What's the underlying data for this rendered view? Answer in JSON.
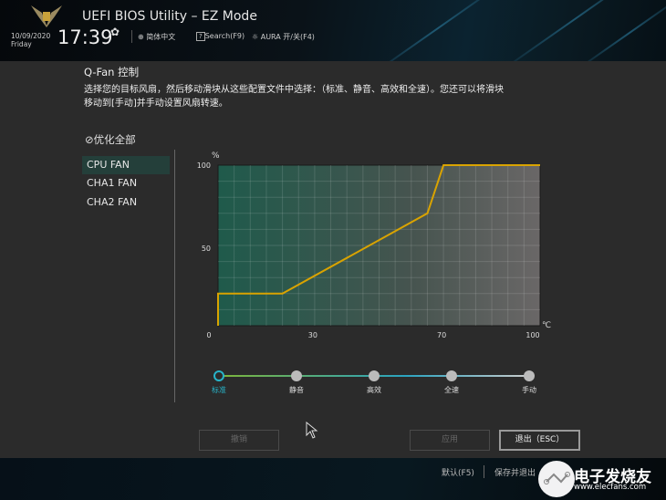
{
  "header": {
    "title": "UEFI BIOS Utility – EZ Mode",
    "date": "10/09/2020",
    "day": "Friday",
    "time": "17:39",
    "language": "简体中文",
    "search": "Search(F9)",
    "aura": "AURA 开/关(F4)"
  },
  "dialog": {
    "title": "Q-Fan 控制",
    "description_line1": "选择您的目标风扇，然后移动滑块从这些配置文件中选择：（标准、静音、高效和全速）。您还可以将滑块",
    "description_line2": "移动到[手动]并手动设置风扇转速。",
    "optimize_all": "优化全部",
    "fans": [
      {
        "label": "CPU FAN",
        "selected": true
      },
      {
        "label": "CHA1 FAN",
        "selected": false
      },
      {
        "label": "CHA2 FAN",
        "selected": false
      }
    ],
    "profiles": [
      {
        "label": "标准",
        "active": true
      },
      {
        "label": "静音",
        "active": false
      },
      {
        "label": "高效",
        "active": false
      },
      {
        "label": "全速",
        "active": false
      },
      {
        "label": "手动",
        "active": false
      }
    ],
    "buttons": {
      "undo": "撤销",
      "apply": "应用",
      "exit": "退出（ESC）"
    }
  },
  "chart_data": {
    "type": "line",
    "xlabel": "℃",
    "ylabel": "%",
    "xlim": [
      0,
      100
    ],
    "ylim": [
      0,
      100
    ],
    "xticks": [
      "0",
      "30",
      "70",
      "100"
    ],
    "yticks": [
      "100",
      "50"
    ],
    "grid": true,
    "line_color": "#d9a300",
    "points": [
      [
        0,
        0
      ],
      [
        0,
        20
      ],
      [
        20,
        20
      ],
      [
        65,
        70
      ],
      [
        70,
        100
      ],
      [
        100,
        100
      ]
    ]
  },
  "footer": {
    "default": "默认(F5)",
    "save_exit": "保存并退出"
  },
  "watermark": {
    "name": "电子发烧友",
    "url": "www.elecfans.com"
  }
}
